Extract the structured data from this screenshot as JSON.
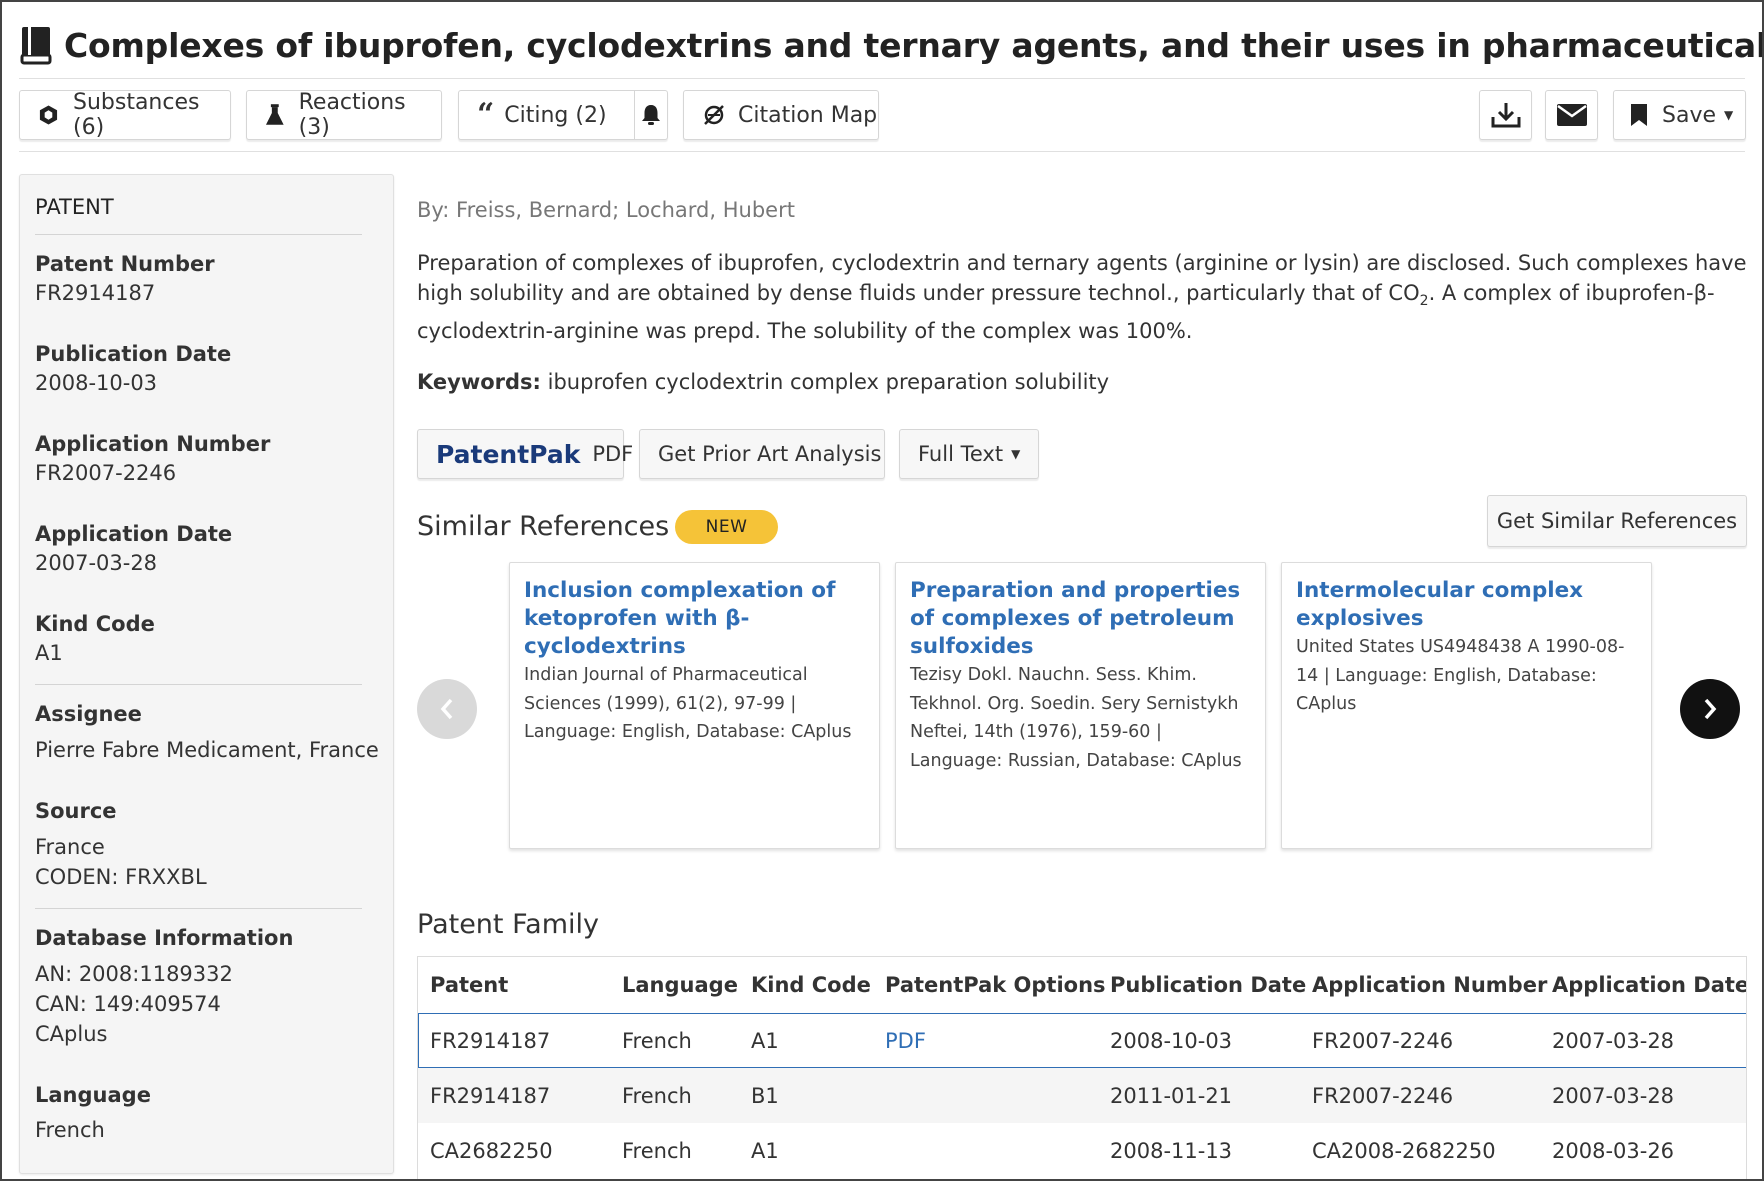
{
  "title": "Complexes of ibuprofen, cyclodextrins and ternary agents, and their uses in pharmaceuticals",
  "toolbar": {
    "substances": "Substances (6)",
    "reactions": "Reactions (3)",
    "citing": "Citing (2)",
    "citation_map": "Citation Map",
    "save": "Save"
  },
  "sidebar": {
    "heading": "PATENT",
    "patent_number_label": "Patent Number",
    "patent_number": "FR2914187",
    "publication_date_label": "Publication Date",
    "publication_date": "2008-10-03",
    "application_number_label": "Application Number",
    "application_number": "FR2007-2246",
    "application_date_label": "Application Date",
    "application_date": "2007-03-28",
    "kind_code_label": "Kind Code",
    "kind_code": "A1",
    "assignee_label": "Assignee",
    "assignee": "Pierre Fabre Medicament, France",
    "source_label": "Source",
    "source_country": "France",
    "source_coden": "CODEN: FRXXBL",
    "database_label": "Database Information",
    "db_an": "AN: 2008:1189332",
    "db_can": "CAN: 149:409574",
    "db_name": "CAplus",
    "language_label": "Language",
    "language": "French"
  },
  "main": {
    "authors": "By: Freiss, Bernard; Lochard, Hubert",
    "abstract_part1": "Preparation of complexes of ibuprofen, cyclodextrin and ternary agents (arginine or lysin) are disclosed. Such complexes have high solubility and are obtained by dense fluids under pressure technol., particularly that of CO",
    "abstract_sub": "2",
    "abstract_part2": ". A complex of ibuprofen-β-cyclodextrin-arginine was prepd. The solubility of the complex was 100%.",
    "keywords_label": "Keywords:",
    "keywords": "ibuprofen cyclodextrin complex preparation solubility",
    "patentpak_brand": "PatentPak",
    "patentpak_pdf": "PDF",
    "prior_art": "Get Prior Art Analysis",
    "full_text": "Full Text",
    "similar_title": "Similar References",
    "new_badge": "NEW",
    "get_similar": "Get Similar References",
    "similar_refs": [
      {
        "title": "Inclusion complexation of ketoprofen with β-cyclodextrins",
        "meta": "Indian Journal of Pharmaceutical Sciences (1999), 61(2), 97-99 | Language: English, Database: CAplus"
      },
      {
        "title": "Preparation and properties of complexes of petroleum sulfoxides",
        "meta": "Tezisy Dokl. Nauchn. Sess. Khim. Tekhnol. Org. Soedin. Sery Sernistykh Neftei, 14th (1976), 159-60 | Language: Russian, Database: CAplus"
      },
      {
        "title": "Intermolecular complex explosives",
        "meta": "United States US4948438 A 1990-08-14 | Language: English, Database: CAplus"
      }
    ],
    "family_title": "Patent Family",
    "family_headers": [
      "Patent",
      "Language",
      "Kind Code",
      "PatentPak Options",
      "Publication Date",
      "Application Number",
      "Application Date"
    ],
    "family_rows": [
      [
        "FR2914187",
        "French",
        "A1",
        "PDF",
        "2008-10-03",
        "FR2007-2246",
        "2007-03-28"
      ],
      [
        "FR2914187",
        "French",
        "B1",
        "",
        "2011-01-21",
        "FR2007-2246",
        "2007-03-28"
      ],
      [
        "CA2682250",
        "French",
        "A1",
        "",
        "2008-11-13",
        "CA2008-2682250",
        "2008-03-26"
      ]
    ]
  },
  "colors": {
    "link": "#2f6eb5",
    "badge": "#f5c338",
    "patentpak": "#1a3a7a",
    "selected_row_border": "#2f6eb5"
  }
}
